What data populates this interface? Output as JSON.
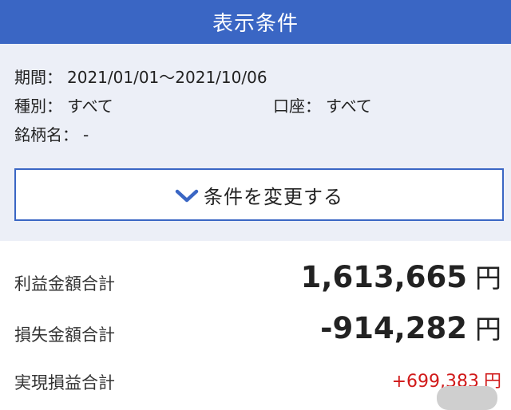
{
  "header": {
    "title": "表示条件"
  },
  "conditions": {
    "period": {
      "label": "期間：",
      "value": "2021/01/01〜2021/10/06"
    },
    "type": {
      "label": "種別：",
      "value": "すべて"
    },
    "account": {
      "label": "口座：",
      "value": "すべて"
    },
    "brand": {
      "label": "銘柄名：",
      "value": "-"
    }
  },
  "change_button": {
    "label": "条件を変更する",
    "icon": "chevron-down-icon"
  },
  "summary": {
    "profit": {
      "label": "利益金額合計",
      "value": "1,613,665",
      "unit": "円"
    },
    "loss": {
      "label": "損失金額合計",
      "value": "-914,282",
      "unit": "円"
    },
    "realized": {
      "label": "実現損益合計",
      "value": "+699,383",
      "unit": "円"
    }
  },
  "colors": {
    "header_bg": "#3a66c4",
    "panel_bg": "#eceff7",
    "positive_red": "#d11a1a"
  }
}
